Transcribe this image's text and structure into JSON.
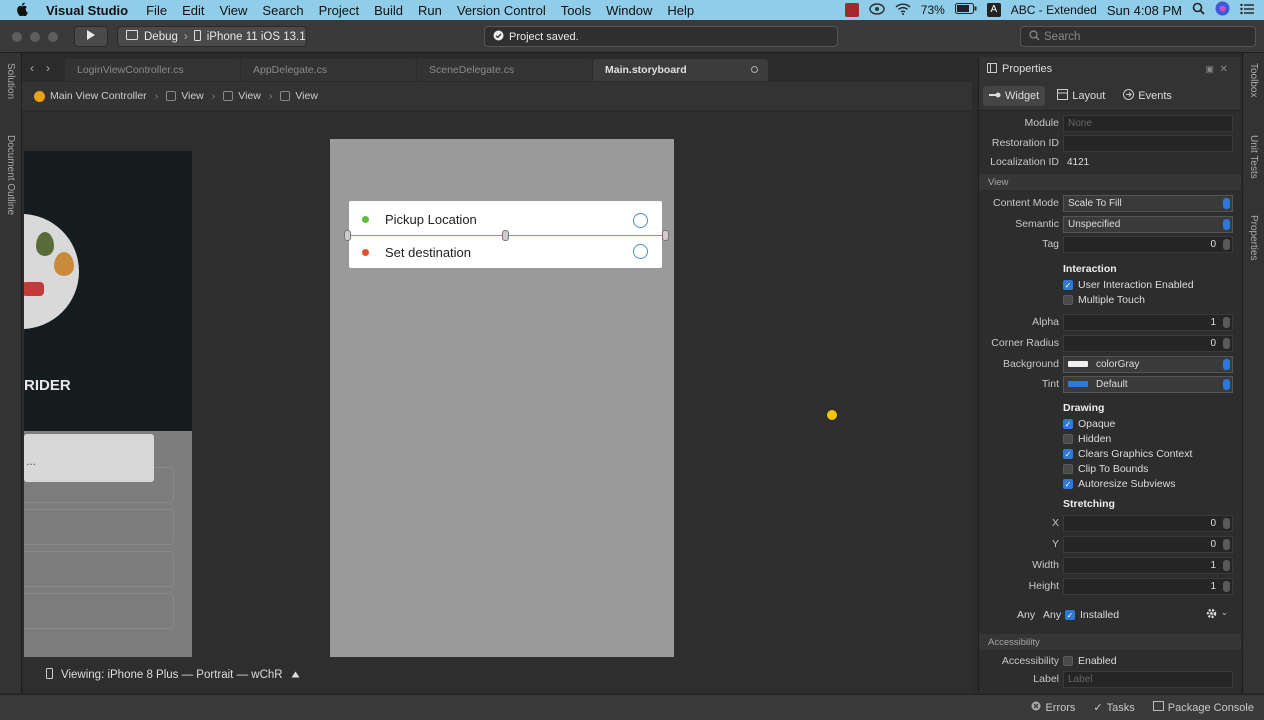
{
  "menubar": {
    "apple": "",
    "app_name": "Visual Studio",
    "items": [
      "File",
      "Edit",
      "View",
      "Search",
      "Project",
      "Build",
      "Run",
      "Version Control",
      "Tools",
      "Window",
      "Help"
    ],
    "battery": "73%",
    "input_source": "ABC - Extended",
    "input_badge": "A",
    "clock": "Sun 4:08 PM"
  },
  "toolbar": {
    "config": "Debug",
    "device": "iPhone 11 iOS 13.1",
    "status": "Project saved.",
    "search_placeholder": "Search"
  },
  "left_rail": {
    "solution": "Solution",
    "outline": "Document Outline"
  },
  "tabs": [
    "LoginViewController.cs",
    "AppDelegate.cs",
    "SceneDelegate.cs",
    "Main.storyboard"
  ],
  "breadcrumb": [
    "Main View Controller",
    "View",
    "View",
    "View"
  ],
  "canvas": {
    "side_title": "RIDER",
    "side_field": "...",
    "pickup_label": "Pickup Location",
    "destination_label": "Set destination",
    "viewing": "Viewing: iPhone 8 Plus — Portrait — wChR"
  },
  "properties": {
    "title": "Properties",
    "tabs": [
      "Widget",
      "Layout",
      "Events"
    ],
    "module_label": "Module",
    "module_placeholder": "None",
    "restoration_label": "Restoration ID",
    "localization_label": "Localization ID",
    "localization_value": "4121",
    "view_section": "View",
    "content_mode_label": "Content Mode",
    "content_mode_value": "Scale To Fill",
    "semantic_label": "Semantic",
    "semantic_value": "Unspecified",
    "tag_label": "Tag",
    "tag_value": "0",
    "interaction_heading": "Interaction",
    "user_interaction": "User Interaction Enabled",
    "multiple_touch": "Multiple Touch",
    "alpha_label": "Alpha",
    "alpha_value": "1",
    "corner_label": "Corner Radius",
    "corner_value": "0",
    "background_label": "Background",
    "background_value": "colorGray",
    "tint_label": "Tint",
    "tint_value": "Default",
    "drawing_heading": "Drawing",
    "opaque": "Opaque",
    "hidden": "Hidden",
    "clears": "Clears Graphics Context",
    "clip": "Clip To Bounds",
    "autoresize": "Autoresize Subviews",
    "stretching_heading": "Stretching",
    "x_label": "X",
    "x_value": "0",
    "y_label": "Y",
    "y_value": "0",
    "width_label": "Width",
    "width_value": "1",
    "height_label": "Height",
    "height_value": "1",
    "any1": "Any",
    "any2": "Any",
    "installed": "Installed",
    "accessibility_section": "Accessibility",
    "accessibility_label": "Accessibility",
    "accessibility_enabled": "Enabled",
    "label_label": "Label",
    "label_placeholder": "Label"
  },
  "right_rail": {
    "toolbox": "Toolbox",
    "unit_tests": "Unit Tests",
    "properties": "Properties"
  },
  "bottombar": {
    "errors": "Errors",
    "tasks": "Tasks",
    "package": "Package Console"
  },
  "colors": {
    "menubar": "#8fcde8",
    "accent": "#2c79d9",
    "pickup_dot": "#5bbf3a",
    "destination_dot": "#e0502a",
    "ring": "#4a90c8"
  }
}
